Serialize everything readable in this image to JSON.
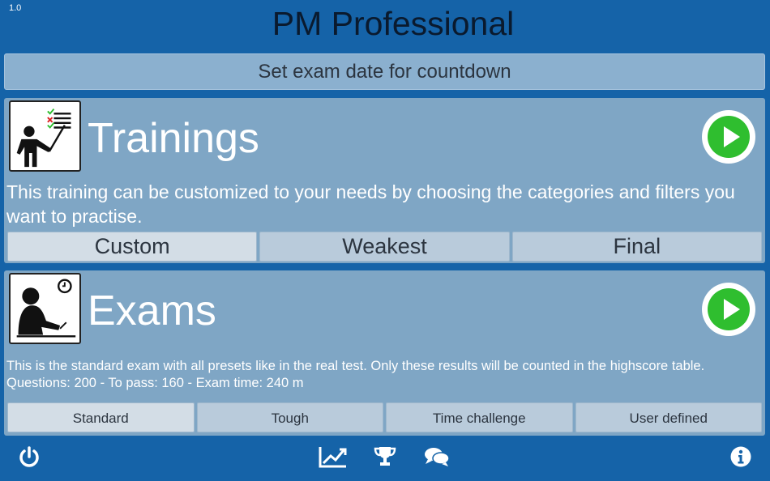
{
  "version": "1.0",
  "app_title": "PM Professional",
  "countdown_label": "Set exam date for countdown",
  "trainings": {
    "icon": "teacher-icon",
    "title": "Trainings",
    "description": "This training can be customized to your needs by choosing the categories and filters you want to practise.",
    "options": [
      "Custom",
      "Weakest",
      "Final"
    ],
    "selected": "Custom"
  },
  "exams": {
    "icon": "exam-writer-icon",
    "title": "Exams",
    "description": "This is the standard exam with all presets like in the real test. Only these results will be counted in the highscore table.",
    "details": "Questions: 200 - To pass: 160 - Exam time: 240 m",
    "options": [
      "Standard",
      "Tough",
      "Time challenge",
      "User defined"
    ],
    "selected": "Standard"
  },
  "bottom_bar": {
    "icons": [
      "power-icon",
      "statistics-chart-icon",
      "trophy-icon",
      "chat-icon",
      "info-icon"
    ]
  },
  "colors": {
    "background": "#1563a8",
    "panel": "#7fa6c5",
    "play_button": "#2fbe2f",
    "option_button": "#b9cbdb"
  }
}
